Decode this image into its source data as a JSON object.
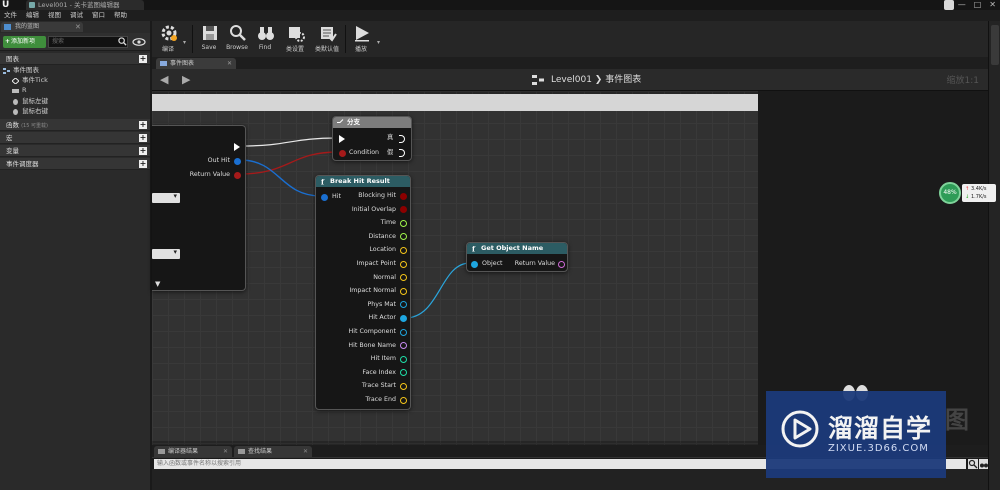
{
  "window": {
    "doc_tab": "Level001 - 关卡蓝图编辑器",
    "minimize": "—",
    "maximize": "□",
    "close": "✕"
  },
  "menu": [
    "文件",
    "编辑",
    "视图",
    "调试",
    "窗口",
    "帮助"
  ],
  "left_panel": {
    "tab": "我的蓝图",
    "tab_close": "✕",
    "add_new": "添加新项",
    "search_placeholder": "搜索",
    "graphs_section": "图表",
    "tree": {
      "event_graph": "事件图表",
      "event_tick": "事件Tick",
      "r": "R",
      "mouse_left": "鼠标左键",
      "mouse_right": "鼠标右键"
    },
    "functions_section": "函数",
    "functions_sub": "(15 可重载)",
    "macros_section": "宏",
    "variables_section": "变量",
    "dispatchers_section": "事件调度器"
  },
  "toolbar": {
    "compile": "编译",
    "save": "Save",
    "browse": "Browse",
    "find": "Find",
    "class_settings": "类设置",
    "class_defaults": "类默认值",
    "play": "播放"
  },
  "graph": {
    "tab": "事件图表",
    "tab_close": "✕",
    "breadcrumb": "Level001 ❯ 事件图表",
    "zoom": "缩放1:1"
  },
  "nodes": {
    "trace": {
      "out_hit": "Out Hit",
      "return_value": "Return Value"
    },
    "branch": {
      "title": "分支",
      "condition": "Condition",
      "true_label": "真",
      "false_label": "假"
    },
    "break_hit": {
      "title": "Break Hit Result",
      "hit": "Hit",
      "outputs": [
        "Blocking Hit",
        "Initial Overlap",
        "Time",
        "Distance",
        "Location",
        "Impact Point",
        "Normal",
        "Impact Normal",
        "Phys Mat",
        "Hit Actor",
        "Hit Component",
        "Hit Bone Name",
        "Hit Item",
        "Face Index",
        "Trace Start",
        "Trace End"
      ]
    },
    "get_name": {
      "title": "Get Object Name",
      "object": "Object",
      "return_value": "Return Value"
    }
  },
  "pin_colors": {
    "exec": "#ffffff",
    "bool": "#8c0000",
    "float": "#9ff44a",
    "vector": "#f5c519",
    "struct": "#0a5aa8",
    "object": "#1ea6e0",
    "name": "#c78af2",
    "int": "#1edfa8",
    "material": "#1ea6e0"
  },
  "bottom": {
    "compiler_tab": "编译器结果",
    "find_tab": "查找结果",
    "tab_close": "✕",
    "console_placeholder": "输入函数或事件名称以搜索引用"
  },
  "fps": {
    "percent": "48%",
    "up": "3.4K/s",
    "down": "1.7K/s"
  },
  "watermark": {
    "title": "溜溜自学",
    "sub": "ZIXUE.3D66.COM",
    "ghost": "图"
  }
}
